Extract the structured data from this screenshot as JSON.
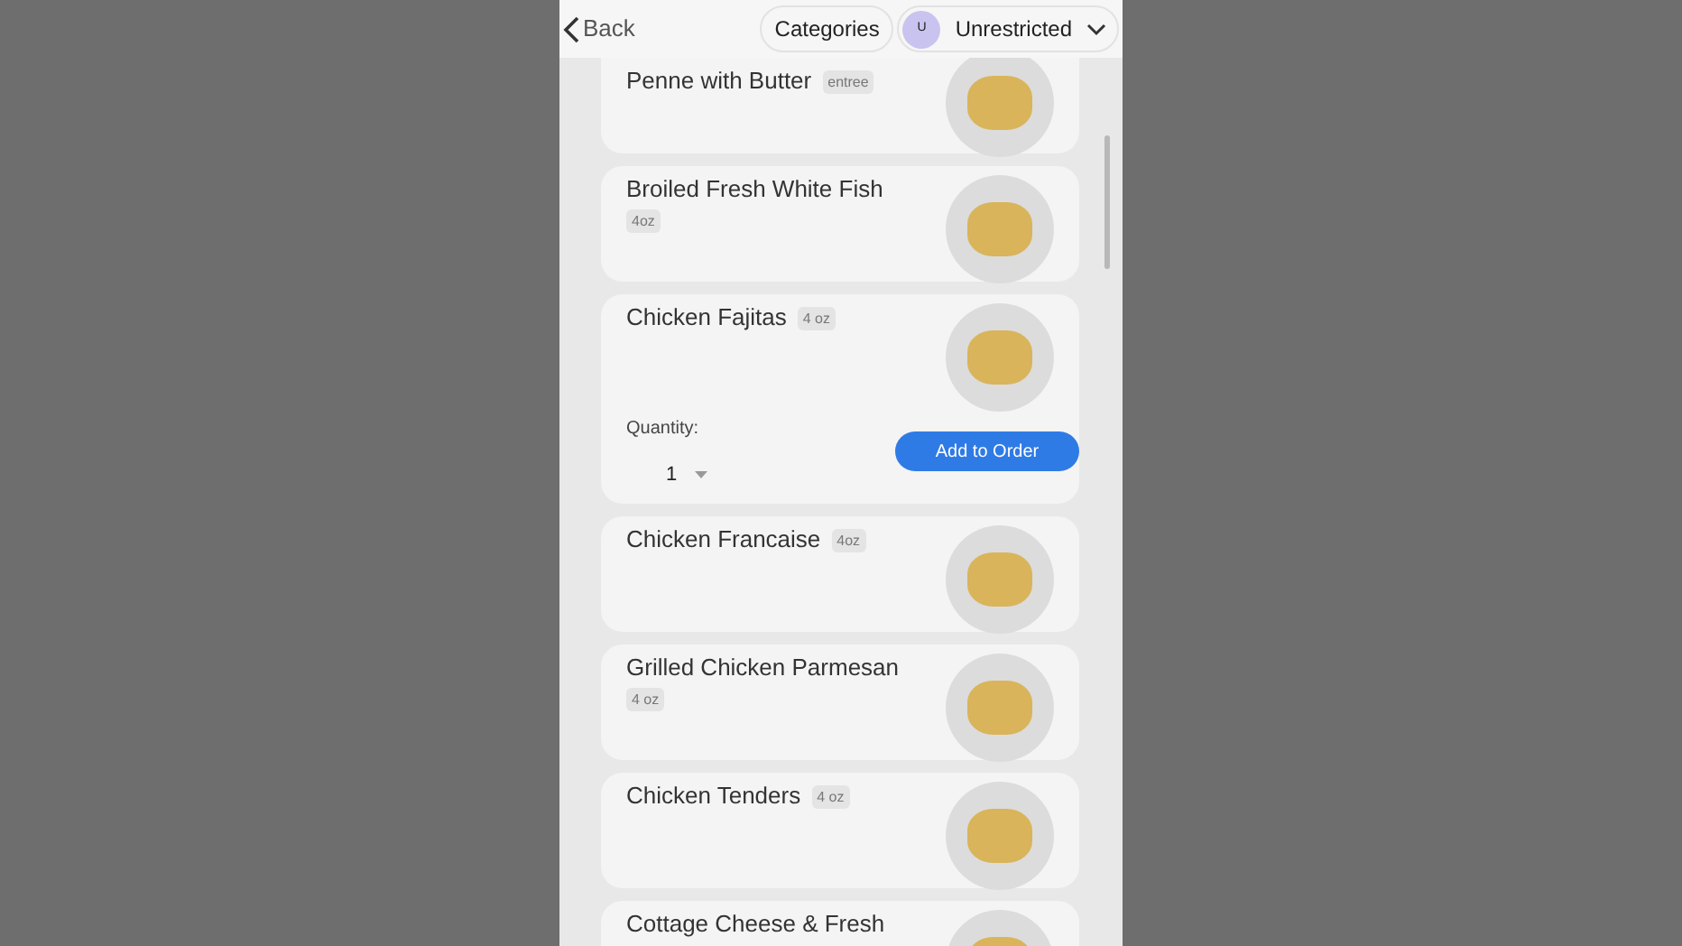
{
  "header": {
    "back": "Back",
    "categories": "Categories",
    "avatar": "U",
    "diet": "Unrestricted"
  },
  "items": [
    {
      "name": "Penne with Butter",
      "tag": "entree",
      "expanded": false
    },
    {
      "name": "Broiled Fresh White Fish",
      "tag": "4oz",
      "expanded": false
    },
    {
      "name": "Chicken Fajitas",
      "tag": "4 oz",
      "expanded": true,
      "quantity_label": "Quantity:",
      "quantity": "1",
      "button": "Add to Order"
    },
    {
      "name": "Chicken Francaise",
      "tag": "4oz",
      "expanded": false
    },
    {
      "name": "Grilled Chicken Parmesan",
      "tag": "4 oz",
      "expanded": false
    },
    {
      "name": "Chicken Tenders",
      "tag": "4 oz",
      "expanded": false
    },
    {
      "name": "Cottage Cheese & Fresh",
      "expanded": false
    }
  ]
}
